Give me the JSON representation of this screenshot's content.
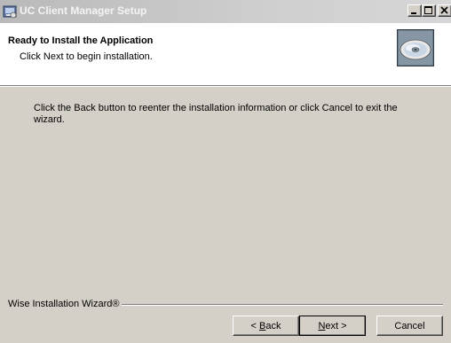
{
  "window": {
    "title": "UC Client Manager Setup",
    "controls": {
      "minimize_icon": "minimize-icon",
      "maximize_icon": "maximize-icon",
      "close_icon": "close-icon"
    }
  },
  "header": {
    "title": "Ready to Install the Application",
    "subtitle": "Click Next to begin installation.",
    "icon": "cd-disc-icon"
  },
  "body": {
    "instructions": "Click the Back button to reenter the installation information or click Cancel to exit the wizard."
  },
  "footer": {
    "brand_label": "Wise Installation Wizard®"
  },
  "buttons": {
    "back_prefix": "< ",
    "back_accel": "B",
    "back_rest": "ack",
    "next_accel": "N",
    "next_rest": "ext >",
    "cancel": "Cancel"
  },
  "colors": {
    "dialog_bg": "#d4d0c8",
    "header_bg": "#ffffff",
    "title_bar": "#c8c8c8"
  }
}
